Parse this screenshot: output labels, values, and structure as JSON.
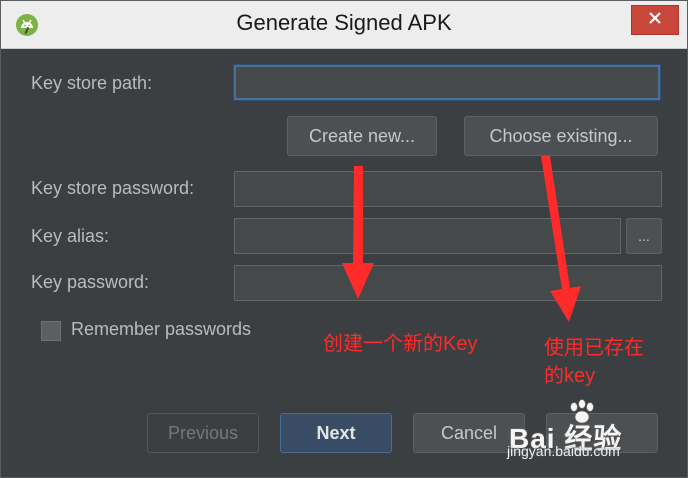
{
  "window": {
    "title": "Generate Signed APK"
  },
  "icons": {
    "app": "android-studio-icon",
    "close": "close-icon",
    "more": "ellipsis-icon"
  },
  "form": {
    "key_store_path_label": "Key store path:",
    "key_store_path_value": "",
    "create_new_label": "Create new...",
    "choose_existing_label": "Choose existing...",
    "key_store_password_label": "Key store password:",
    "key_store_password_value": "",
    "key_alias_label": "Key alias:",
    "key_alias_value": "",
    "key_alias_browse_label": "...",
    "key_password_label": "Key password:",
    "key_password_value": "",
    "remember_label": "Remember passwords",
    "remember_checked": false
  },
  "buttons": {
    "previous": "Previous",
    "next": "Next",
    "cancel": "Cancel"
  },
  "annotations": {
    "create_new_note": "创建一个新的Key",
    "use_existing_note_line1": "使用已存在",
    "use_existing_note_line2": "的key",
    "color": "#ff2a2a"
  },
  "watermark": {
    "logo": "Bai 经验",
    "url": "jingyan.baidu.com"
  },
  "colors": {
    "dialog_bg": "#3c3f41",
    "focus_border": "#4a6f98",
    "primary_button": "#384c66"
  }
}
